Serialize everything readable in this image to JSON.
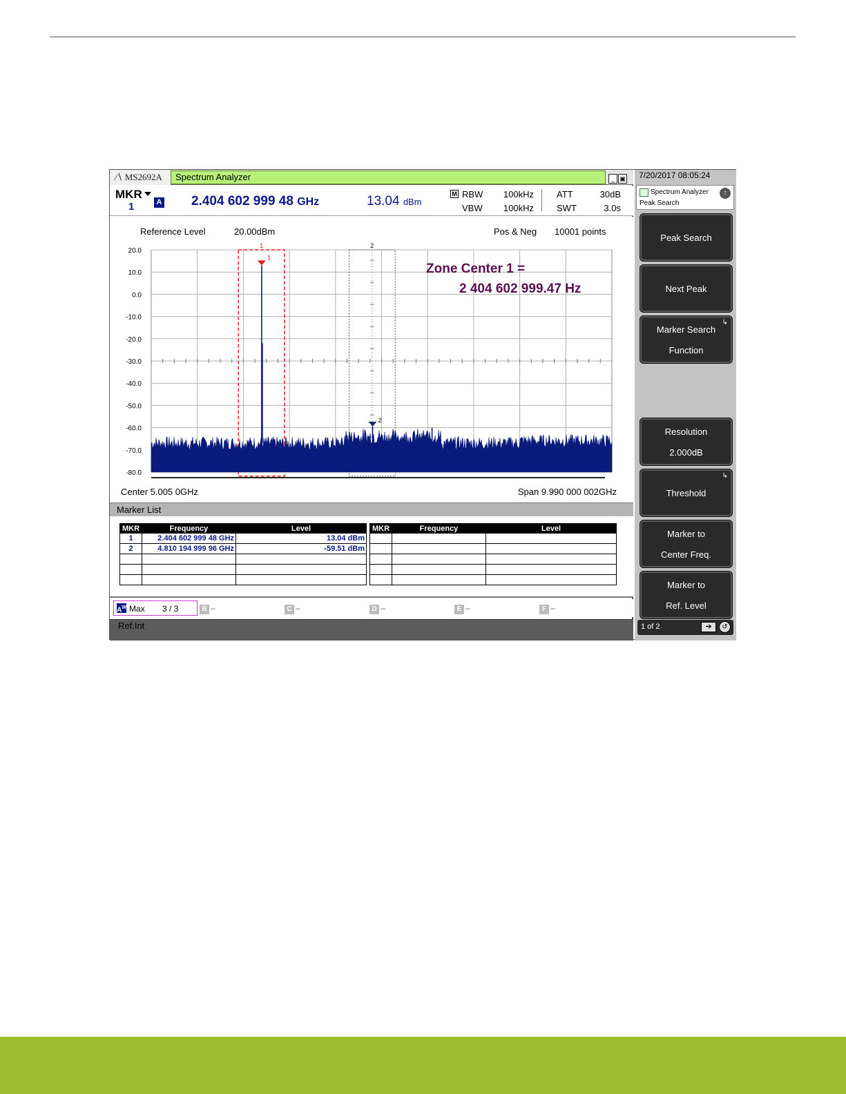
{
  "instrument": {
    "model": "MS2692A",
    "app_title": "Spectrum Analyzer",
    "timestamp": "7/20/2017 08:05:24"
  },
  "marker_readout": {
    "label": "MKR",
    "number": "1",
    "trace": "A",
    "frequency": "2.404 602 999 48",
    "frequency_unit": "GHz",
    "level": "13.04",
    "level_unit": "dBm"
  },
  "params": {
    "m_badge": "M",
    "rbw_label": "RBW",
    "rbw_value": "100kHz",
    "vbw_label": "VBW",
    "vbw_value": "100kHz",
    "att_label": "ATT",
    "att_value": "30dB",
    "swt_label": "SWT",
    "swt_value": "3.0s"
  },
  "plot": {
    "reference_level_label": "Reference Level",
    "reference_level_value": "20.00dBm",
    "detector": "Pos & Neg",
    "points": "10001 points",
    "center": "Center 5.005 0GHz",
    "span": "Span 9.990 000 002GHz",
    "annotation_line1": "Zone Center 1 =",
    "annotation_line2": "2 404 602 999.47 Hz",
    "zone1_label": "1",
    "zone2_label": "2",
    "marker1_label": "1",
    "marker2_label": "2",
    "colors": {
      "trace": "#0a1a7a",
      "zone1": "#e02020",
      "annotation": "#5a1050",
      "grid": "#b0b0b0"
    }
  },
  "chart_data": {
    "type": "line",
    "y_ticks": [
      "20.0",
      "10.0",
      "0.0",
      "-10.0",
      "-20.0",
      "-30.0",
      "-40.0",
      "-50.0",
      "-60.0",
      "-70.0",
      "-80.0"
    ],
    "y_tick_values": [
      20,
      10,
      0,
      -10,
      -20,
      -30,
      -40,
      -50,
      -60,
      -70,
      -80
    ],
    "ylim": [
      -80,
      20
    ],
    "xlim_ghz": [
      0.01,
      10.0
    ],
    "grid": true,
    "noise_floor_dbm": -67,
    "peaks": [
      {
        "x_ghz": 2.4046,
        "y_dbm": 13.04
      },
      {
        "x_ghz": 2.42,
        "y_dbm": -22
      },
      {
        "x_ghz": 4.8102,
        "y_dbm": -59.51
      },
      {
        "x_ghz": 6.1,
        "y_dbm": -60
      }
    ],
    "zones": [
      {
        "label": "1",
        "x_start_ghz": 1.9,
        "x_end_ghz": 2.9
      },
      {
        "label": "2",
        "x_start_ghz": 4.3,
        "x_end_ghz": 5.3
      }
    ]
  },
  "marker_list": {
    "title": "Marker List",
    "headers": [
      "MKR",
      "Frequency",
      "Level"
    ],
    "rows": [
      {
        "mkr": "1",
        "frequency": "2.404 602 999 48 GHz",
        "level": "13.04 dBm"
      },
      {
        "mkr": "2",
        "frequency": "4.810 194 999 96 GHz",
        "level": "-59.51 dBm"
      }
    ]
  },
  "traces": {
    "a_badge": "A",
    "a_sup": "W",
    "a_mode": "Max",
    "a_storage": "3 / 3",
    "b": "B",
    "c": "C",
    "d": "D",
    "e": "E",
    "f": "F",
    "off_mark": "–"
  },
  "status": {
    "ref": "Ref.Int"
  },
  "side_panel": {
    "header_title": "Spectrum Analyzer",
    "header_sub": "Peak Search",
    "keys": [
      {
        "line1": "Peak Search",
        "line2": ""
      },
      {
        "line1": "Next Peak",
        "line2": ""
      },
      {
        "line1": "Marker Search",
        "line2": "Function"
      },
      {
        "line1": "Resolution",
        "line2": "2.000dB"
      },
      {
        "line1": "Threshold",
        "line2": ""
      },
      {
        "line1": "Marker to",
        "line2": "Center Freq."
      },
      {
        "line1": "Marker to",
        "line2": "Ref. Level"
      }
    ],
    "page_indicator": "1 of 2"
  }
}
